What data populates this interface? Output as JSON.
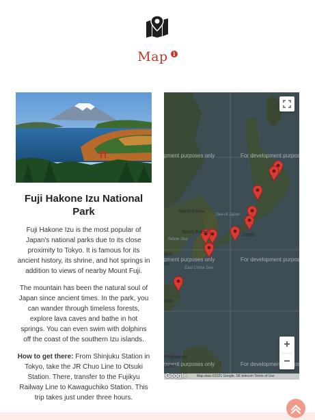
{
  "header": {
    "icon": "map-icon",
    "title": "Map",
    "info_badge": "i"
  },
  "card": {
    "image_alt": "Mount Fuji over Lake Ashi with red torii gate",
    "name": "Fuji Hakone Izu National Park",
    "paragraphs": [
      "Fuji Hakone Izu is the most popular of Japan's national parks due to its close proximity to Tokyo. It is famous for its ancient history, its shrine, and hot springs in addition to views of nearby Mount Fuji.",
      "The mountain has been the natural soul of Japan since ancient times. In the park, you can wander through timeless forests, explore lava caves and bathe in hot springs. You can even swim with dolphins off the coast of the southern Izu islands."
    ],
    "how_to_label": "How to get there:",
    "how_to_text": " From Shinjuku Station in Tokyo, take the JR Chuo Line to Otsuki Station. There, transfer to the Fujikyu Railway Line to Kawaguchiko Station. This trip takes just under three hours."
  },
  "map": {
    "watermark": "For development purposes only",
    "watermark_left": "pment purposes only",
    "labels": {
      "north_korea": "North Korea",
      "south_korea": "South Korea",
      "sea_of_japan": "Sea of Japan",
      "yellow_sea": "Yellow Sea",
      "east_china_sea": "East China Sea",
      "japan": "Japan",
      "philippines": "Philippines",
      "taiwan": "wan",
      "gha": "gha",
      "ppine": "ppine",
      "pu": "pu"
    },
    "zoom_in": "+",
    "zoom_out": "−",
    "attribution": "Map data ©2021 Google, SK telecom   Terms of Use",
    "google_logo": "Google"
  },
  "colors": {
    "accent": "#c0392b",
    "marker": "#d63c33",
    "scroll_button": "#f29a8a"
  }
}
